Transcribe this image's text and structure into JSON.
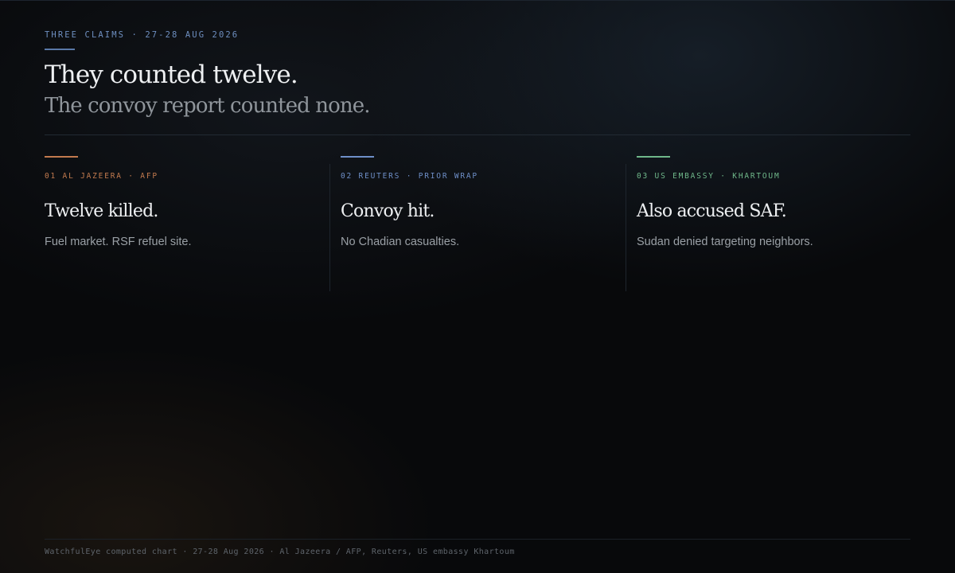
{
  "header": {
    "kicker": "THREE CLAIMS · 27-28 AUG 2026",
    "headline": "They counted twelve.",
    "subheadline": "The convoy report counted none."
  },
  "claims": [
    {
      "source": "01 AL JAZEERA · AFP",
      "title": "Twelve killed.",
      "body": "Fuel market. RSF refuel site.",
      "accent_color": "#c27a4e"
    },
    {
      "source": "02 REUTERS · PRIOR WRAP",
      "title": "Convoy hit.",
      "body": "No Chadian casualties.",
      "accent_color": "#6e8fc8"
    },
    {
      "source": "03 US EMBASSY · KHARTOUM",
      "title": "Also accused SAF.",
      "body": "Sudan denied targeting neighbors.",
      "accent_color": "#6fb88a"
    }
  ],
  "footer": {
    "text": "WatchfulEye computed chart · 27-28 Aug 2026 · Al Jazeera / AFP, Reuters, US embassy Khartoum"
  }
}
